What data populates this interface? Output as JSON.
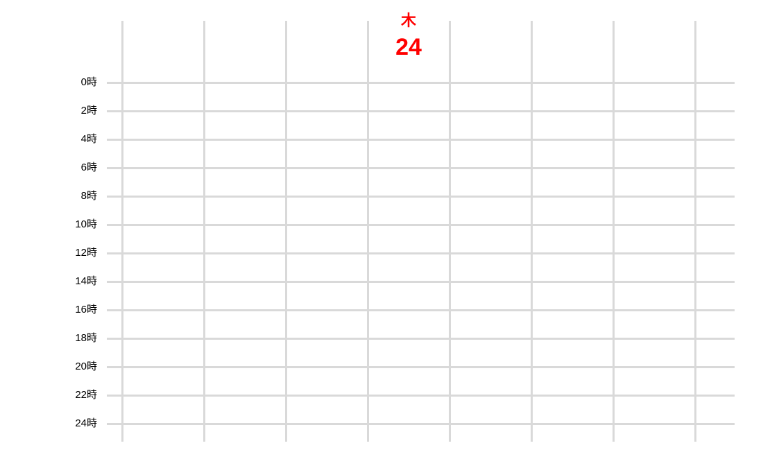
{
  "calendar": {
    "highlight_color": "#ff0000",
    "grid_color": "#d9d9d9",
    "columns": 8,
    "highlighted_day": {
      "column_index": 3,
      "weekday": "木",
      "date": "24"
    },
    "hour_labels": [
      "0時",
      "2時",
      "4時",
      "6時",
      "8時",
      "10時",
      "12時",
      "14時",
      "16時",
      "18時",
      "20時",
      "22時",
      "24時"
    ]
  }
}
